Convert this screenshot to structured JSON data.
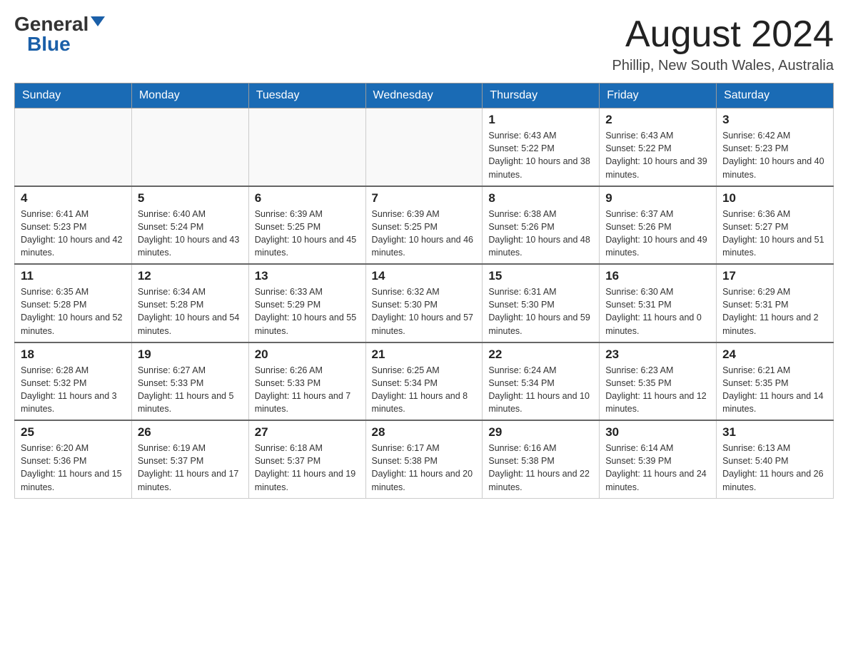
{
  "header": {
    "logo_general": "General",
    "logo_blue": "Blue",
    "month": "August 2024",
    "location": "Phillip, New South Wales, Australia"
  },
  "weekdays": [
    "Sunday",
    "Monday",
    "Tuesday",
    "Wednesday",
    "Thursday",
    "Friday",
    "Saturday"
  ],
  "weeks": [
    [
      {
        "day": "",
        "info": ""
      },
      {
        "day": "",
        "info": ""
      },
      {
        "day": "",
        "info": ""
      },
      {
        "day": "",
        "info": ""
      },
      {
        "day": "1",
        "info": "Sunrise: 6:43 AM\nSunset: 5:22 PM\nDaylight: 10 hours and 38 minutes."
      },
      {
        "day": "2",
        "info": "Sunrise: 6:43 AM\nSunset: 5:22 PM\nDaylight: 10 hours and 39 minutes."
      },
      {
        "day": "3",
        "info": "Sunrise: 6:42 AM\nSunset: 5:23 PM\nDaylight: 10 hours and 40 minutes."
      }
    ],
    [
      {
        "day": "4",
        "info": "Sunrise: 6:41 AM\nSunset: 5:23 PM\nDaylight: 10 hours and 42 minutes."
      },
      {
        "day": "5",
        "info": "Sunrise: 6:40 AM\nSunset: 5:24 PM\nDaylight: 10 hours and 43 minutes."
      },
      {
        "day": "6",
        "info": "Sunrise: 6:39 AM\nSunset: 5:25 PM\nDaylight: 10 hours and 45 minutes."
      },
      {
        "day": "7",
        "info": "Sunrise: 6:39 AM\nSunset: 5:25 PM\nDaylight: 10 hours and 46 minutes."
      },
      {
        "day": "8",
        "info": "Sunrise: 6:38 AM\nSunset: 5:26 PM\nDaylight: 10 hours and 48 minutes."
      },
      {
        "day": "9",
        "info": "Sunrise: 6:37 AM\nSunset: 5:26 PM\nDaylight: 10 hours and 49 minutes."
      },
      {
        "day": "10",
        "info": "Sunrise: 6:36 AM\nSunset: 5:27 PM\nDaylight: 10 hours and 51 minutes."
      }
    ],
    [
      {
        "day": "11",
        "info": "Sunrise: 6:35 AM\nSunset: 5:28 PM\nDaylight: 10 hours and 52 minutes."
      },
      {
        "day": "12",
        "info": "Sunrise: 6:34 AM\nSunset: 5:28 PM\nDaylight: 10 hours and 54 minutes."
      },
      {
        "day": "13",
        "info": "Sunrise: 6:33 AM\nSunset: 5:29 PM\nDaylight: 10 hours and 55 minutes."
      },
      {
        "day": "14",
        "info": "Sunrise: 6:32 AM\nSunset: 5:30 PM\nDaylight: 10 hours and 57 minutes."
      },
      {
        "day": "15",
        "info": "Sunrise: 6:31 AM\nSunset: 5:30 PM\nDaylight: 10 hours and 59 minutes."
      },
      {
        "day": "16",
        "info": "Sunrise: 6:30 AM\nSunset: 5:31 PM\nDaylight: 11 hours and 0 minutes."
      },
      {
        "day": "17",
        "info": "Sunrise: 6:29 AM\nSunset: 5:31 PM\nDaylight: 11 hours and 2 minutes."
      }
    ],
    [
      {
        "day": "18",
        "info": "Sunrise: 6:28 AM\nSunset: 5:32 PM\nDaylight: 11 hours and 3 minutes."
      },
      {
        "day": "19",
        "info": "Sunrise: 6:27 AM\nSunset: 5:33 PM\nDaylight: 11 hours and 5 minutes."
      },
      {
        "day": "20",
        "info": "Sunrise: 6:26 AM\nSunset: 5:33 PM\nDaylight: 11 hours and 7 minutes."
      },
      {
        "day": "21",
        "info": "Sunrise: 6:25 AM\nSunset: 5:34 PM\nDaylight: 11 hours and 8 minutes."
      },
      {
        "day": "22",
        "info": "Sunrise: 6:24 AM\nSunset: 5:34 PM\nDaylight: 11 hours and 10 minutes."
      },
      {
        "day": "23",
        "info": "Sunrise: 6:23 AM\nSunset: 5:35 PM\nDaylight: 11 hours and 12 minutes."
      },
      {
        "day": "24",
        "info": "Sunrise: 6:21 AM\nSunset: 5:35 PM\nDaylight: 11 hours and 14 minutes."
      }
    ],
    [
      {
        "day": "25",
        "info": "Sunrise: 6:20 AM\nSunset: 5:36 PM\nDaylight: 11 hours and 15 minutes."
      },
      {
        "day": "26",
        "info": "Sunrise: 6:19 AM\nSunset: 5:37 PM\nDaylight: 11 hours and 17 minutes."
      },
      {
        "day": "27",
        "info": "Sunrise: 6:18 AM\nSunset: 5:37 PM\nDaylight: 11 hours and 19 minutes."
      },
      {
        "day": "28",
        "info": "Sunrise: 6:17 AM\nSunset: 5:38 PM\nDaylight: 11 hours and 20 minutes."
      },
      {
        "day": "29",
        "info": "Sunrise: 6:16 AM\nSunset: 5:38 PM\nDaylight: 11 hours and 22 minutes."
      },
      {
        "day": "30",
        "info": "Sunrise: 6:14 AM\nSunset: 5:39 PM\nDaylight: 11 hours and 24 minutes."
      },
      {
        "day": "31",
        "info": "Sunrise: 6:13 AM\nSunset: 5:40 PM\nDaylight: 11 hours and 26 minutes."
      }
    ]
  ]
}
